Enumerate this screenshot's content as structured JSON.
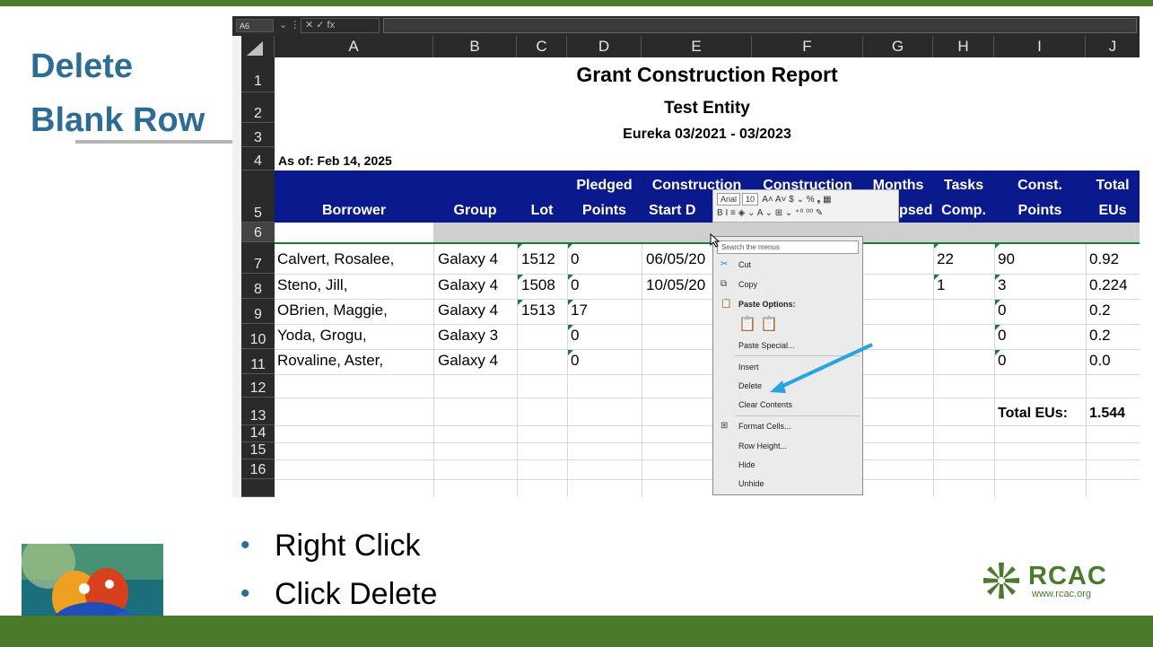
{
  "slide": {
    "title_line1": "Delete",
    "title_line2": "Blank Row",
    "bullets": [
      "Right Click",
      "Click Delete"
    ],
    "logo_text": "RCAC",
    "logo_url": "www.rcac.org"
  },
  "formula_bar": {
    "name_box": "A6",
    "controls": "⌄ ⋮",
    "fx": "✕ ✓ fx",
    "value": ""
  },
  "columns": [
    "A",
    "B",
    "C",
    "D",
    "E",
    "F",
    "G",
    "H",
    "I",
    "J"
  ],
  "rows": [
    "1",
    "2",
    "3",
    "4",
    "5",
    "6",
    "7",
    "8",
    "9",
    "10",
    "11",
    "12",
    "13",
    "14",
    "15",
    "16"
  ],
  "report": {
    "title": "Grant Construction Report",
    "entity": "Test Entity",
    "period": "Eureka 03/2021 - 03/2023",
    "as_of": "As of: Feb 14, 2025"
  },
  "header_top": {
    "D": "Pledged",
    "E": "Construction",
    "F": "Construction",
    "G": "Months",
    "H": "Tasks",
    "I": "Const.",
    "J": "Total"
  },
  "header_bottom": {
    "A": "Borrower",
    "B": "Group",
    "C": "Lot",
    "D": "Points",
    "E": "Start D",
    "G": "psed",
    "H": "Comp.",
    "I": "Points",
    "J": "EUs"
  },
  "data_rows": [
    {
      "a": "Calvert, Rosalee,",
      "b": "Galaxy 4",
      "c": "1512",
      "d": "0",
      "e": "06/05/20",
      "h": "22",
      "i": "90",
      "j": "0.92"
    },
    {
      "a": "Steno, Jill,",
      "b": "Galaxy 4",
      "c": "1508",
      "d": "0",
      "e": "10/05/20",
      "h": "1",
      "i": "3",
      "j": "0.224"
    },
    {
      "a": "OBrien, Maggie,",
      "b": "Galaxy 4",
      "c": "1513",
      "d": "17",
      "e": "",
      "h": "",
      "i": "0",
      "j": "0.2"
    },
    {
      "a": "Yoda, Grogu,",
      "b": "Galaxy 3",
      "c": "",
      "d": "0",
      "e": "",
      "h": "",
      "i": "0",
      "j": "0.2"
    },
    {
      "a": "Rovaline, Aster,",
      "b": "Galaxy 4",
      "c": "",
      "d": "0",
      "e": "",
      "h": "",
      "i": "0",
      "j": "0.0"
    }
  ],
  "totals": {
    "label": "Total EUs:",
    "value": "1.544"
  },
  "mini_toolbar": {
    "font": "Arial",
    "size": "10",
    "row1_tools": "A˄ A˅ $ ⌄ % ❟ ▦",
    "row2_tools": "B I ≡ ◈ ⌄ A ⌄ ⊞ ⌄ ⁺⁰ ⁰⁰ ✎"
  },
  "context_menu": {
    "search": "Search the menus",
    "cut": "Cut",
    "copy": "Copy",
    "paste_options": "Paste Options:",
    "paste_special": "Paste Special...",
    "insert": "Insert",
    "delete": "Delete",
    "clear_contents": "Clear Contents",
    "format_cells": "Format Cells...",
    "row_height": "Row Height...",
    "hide": "Hide",
    "unhide": "Unhide"
  },
  "colors": {
    "accent_green": "#4a7a2c",
    "title_blue": "#2d6c94",
    "header_navy": "#0a1a8c",
    "arrow_blue": "#2aa4e0"
  }
}
